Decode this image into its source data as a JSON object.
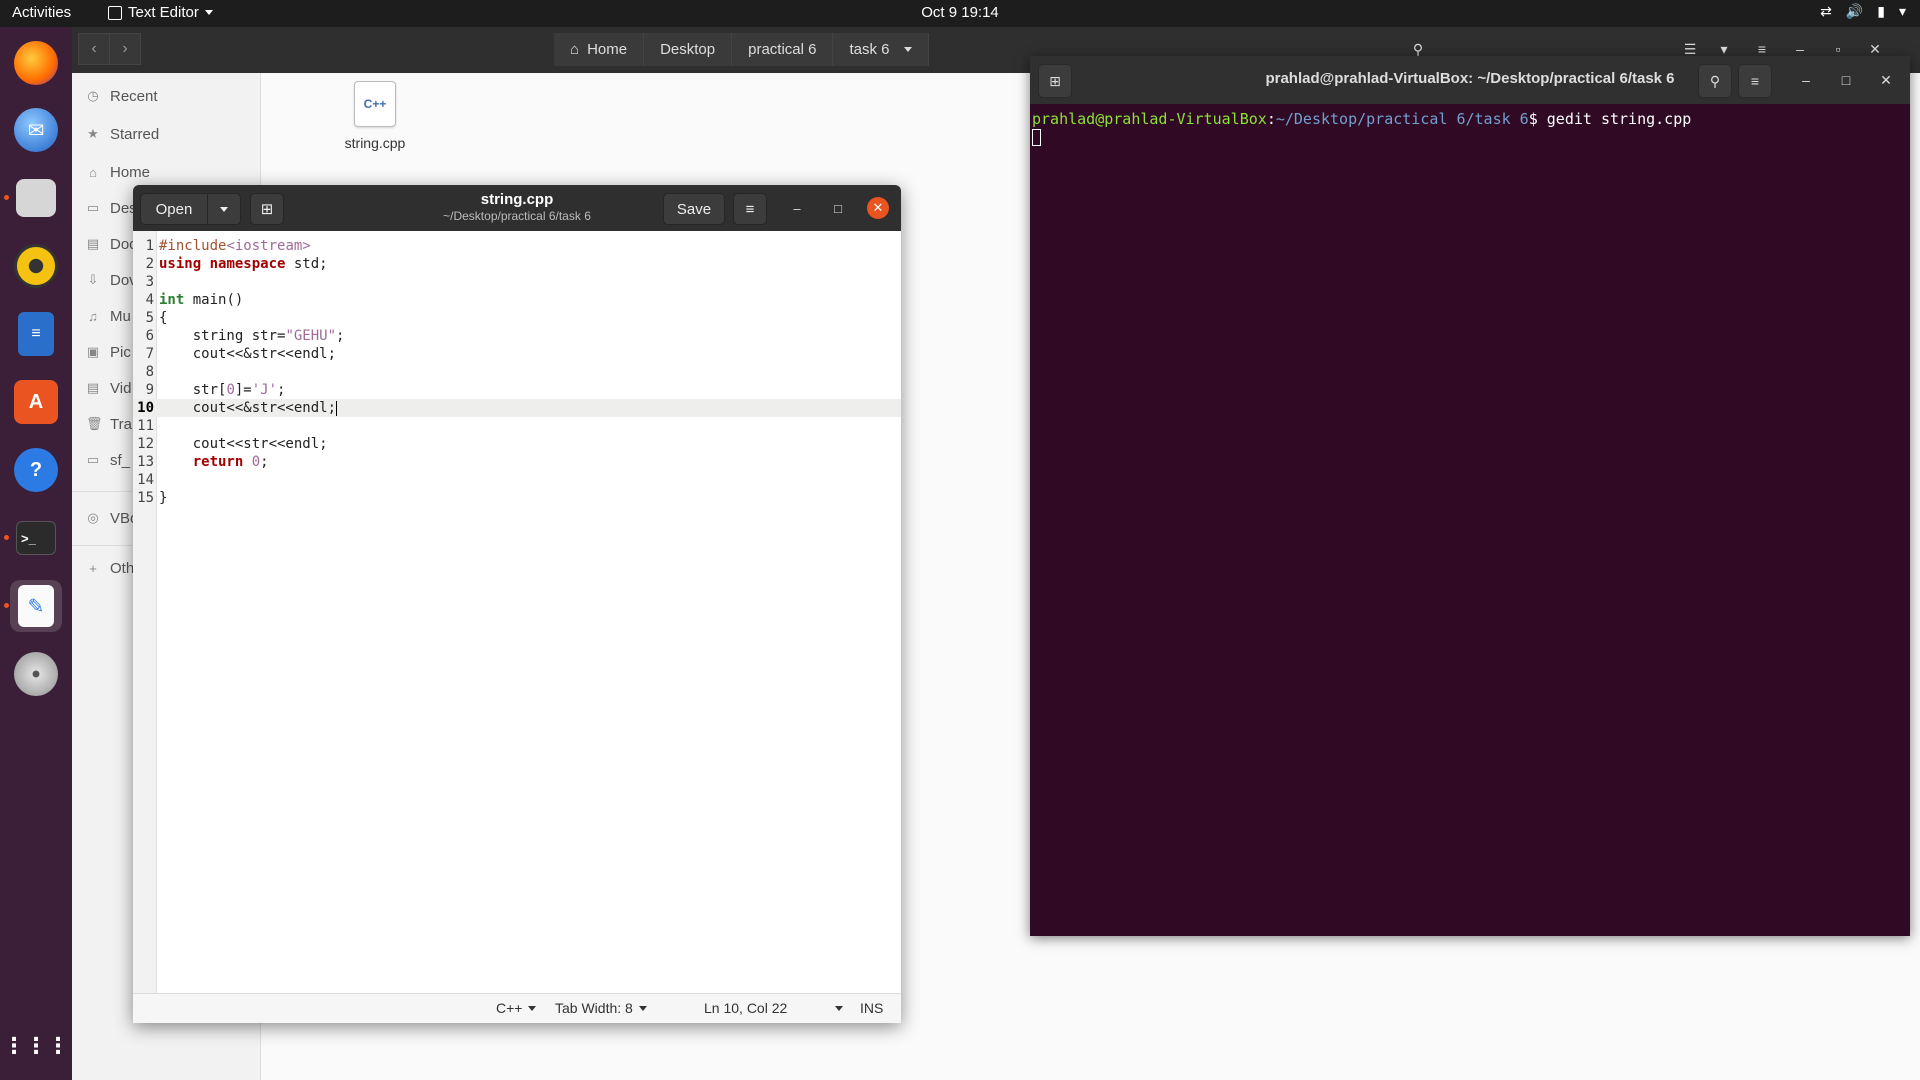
{
  "topbar": {
    "activities": "Activities",
    "app_menu": "Text Editor",
    "clock": "Oct 9  19:14"
  },
  "dock": {
    "apps": [
      "Firefox",
      "Thunderbird",
      "Files",
      "Rhythmbox",
      "LibreOffice Writer",
      "Ubuntu Software",
      "Help",
      "Terminal",
      "Text Editor",
      "DVD",
      "Show Applications"
    ]
  },
  "files": {
    "breadcrumbs": [
      "Home",
      "Desktop",
      "practical 6",
      "task 6"
    ],
    "sidebar": [
      "Recent",
      "Starred",
      "Home",
      "Des",
      "Doc",
      "Dov",
      "Mu",
      "Pic",
      "Vid",
      "Tra",
      "sf_",
      "VBo",
      "Oth"
    ],
    "file_icon_label": "C++",
    "file_name": "string.cpp"
  },
  "terminal": {
    "title": "prahlad@prahlad-VirtualBox: ~/Desktop/practical 6/task 6",
    "prompt_user": "prahlad@prahlad-VirtualBox",
    "prompt_sep": ":",
    "prompt_path": "~/Desktop/practical 6/task 6",
    "prompt_dollar": "$ ",
    "command": "gedit string.cpp"
  },
  "gedit": {
    "open_label": "Open",
    "save_label": "Save",
    "title": "string.cpp",
    "subtitle": "~/Desktop/practical 6/task 6",
    "current_line": 10,
    "code_lines": [
      "#include<iostream>",
      "using namespace std;",
      "",
      "int main()",
      "{",
      "    string str=\"GEHU\";",
      "    cout<<&str<<endl;",
      "",
      "    str[0]='J';",
      "    cout<<&str<<endl;",
      "",
      "    cout<<str<<endl;",
      "    return 0;",
      "",
      "}"
    ],
    "status": {
      "language": "C++",
      "tab_width": "Tab Width: 8",
      "position": "Ln 10, Col 22",
      "mode": "INS"
    }
  }
}
